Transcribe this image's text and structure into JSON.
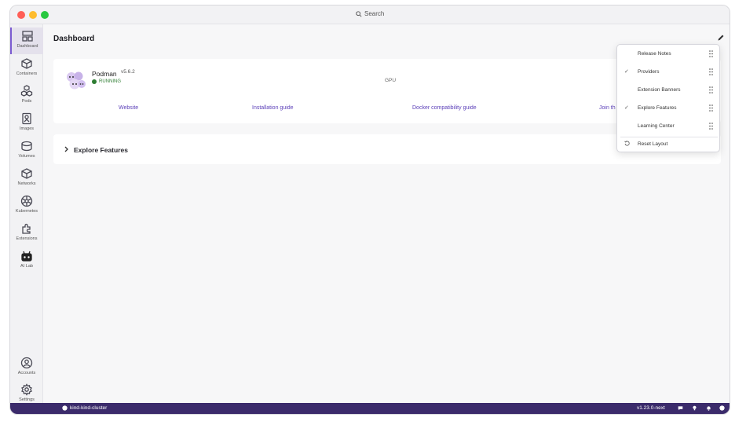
{
  "titlebar": {
    "search_label": "Search"
  },
  "sidebar": {
    "items": [
      {
        "label": "Dashboard",
        "icon": "dashboard-icon"
      },
      {
        "label": "Containers",
        "icon": "container-icon"
      },
      {
        "label": "Pods",
        "icon": "pods-icon"
      },
      {
        "label": "Images",
        "icon": "images-icon"
      },
      {
        "label": "Volumes",
        "icon": "volumes-icon"
      },
      {
        "label": "Networks",
        "icon": "networks-icon"
      },
      {
        "label": "Kubernetes",
        "icon": "kubernetes-icon"
      },
      {
        "label": "Extensions",
        "icon": "extensions-icon"
      },
      {
        "label": "AI Lab",
        "icon": "ai-lab-icon"
      }
    ],
    "bottom_items": [
      {
        "label": "Accounts",
        "icon": "accounts-icon"
      },
      {
        "label": "Settings",
        "icon": "settings-icon"
      }
    ]
  },
  "main": {
    "title": "Dashboard",
    "podman_card": {
      "name": "Podman",
      "version": "v5.6.2",
      "status": "RUNNING",
      "gpu_label": "GPU",
      "links": [
        "Website",
        "Installation guide",
        "Docker compatibility guide",
        "Join th"
      ]
    },
    "explore_card": {
      "label": "Explore Features"
    }
  },
  "layout_menu": {
    "items": [
      {
        "label": "Release Notes",
        "checked": false
      },
      {
        "label": "Providers",
        "checked": true
      },
      {
        "label": "Extension Banners",
        "checked": false
      },
      {
        "label": "Explore Features",
        "checked": true
      },
      {
        "label": "Learning Center",
        "checked": false
      }
    ],
    "check_glyph": "✓",
    "reset_label": "Reset Layout"
  },
  "statusbar": {
    "context_label": "kind-kind-cluster",
    "version_label": "v1.23.0-next"
  },
  "colors": {
    "accent": "#7b5bd1",
    "link": "#5b3fb8",
    "statusbar": "#3b2b6b",
    "running": "#2e7d32"
  }
}
